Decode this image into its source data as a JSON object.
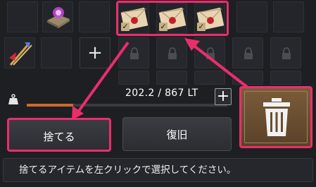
{
  "inventory": {
    "row1": [
      {
        "type": "empty"
      },
      {
        "type": "item",
        "icon": "magic-book-icon"
      },
      {
        "type": "empty"
      },
      {
        "type": "item",
        "icon": "sealed-letter-icon",
        "checked": true
      },
      {
        "type": "item",
        "icon": "sealed-letter-icon",
        "checked": true
      },
      {
        "type": "item",
        "icon": "sealed-letter-icon",
        "checked": true
      }
    ],
    "row2": [
      {
        "type": "item",
        "icon": "arrows-icon"
      },
      {
        "type": "empty"
      },
      {
        "type": "add"
      },
      {
        "type": "locked"
      },
      {
        "type": "locked"
      },
      {
        "type": "locked"
      },
      {
        "type": "locked"
      },
      {
        "type": "locked"
      },
      {
        "type": "locked"
      },
      {
        "type": "locked"
      }
    ],
    "add_symbol": "+",
    "check_symbol": "✓"
  },
  "weight": {
    "text": "202.2 / 867 LT",
    "fill_fraction": 0.233,
    "plus_symbol": "+"
  },
  "buttons": {
    "discard": "捨てる",
    "restore": "復旧"
  },
  "message": "捨てるアイテムを左クリックで選択してください。",
  "colors": {
    "highlight": "#ea2e6c",
    "trash_gold": "#7a5c3a",
    "weight_fill": "#d06a26"
  }
}
